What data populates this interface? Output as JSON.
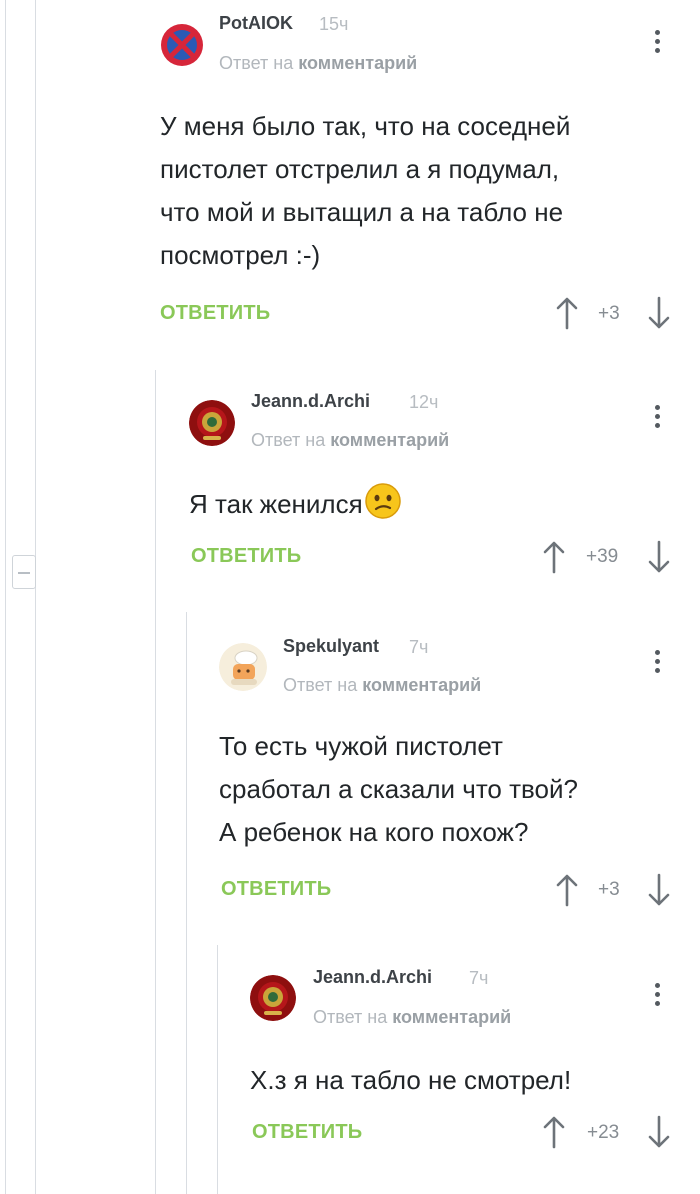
{
  "colors": {
    "accent_green": "#8ac858",
    "thread_line": "#d9dde2"
  },
  "comments": [
    {
      "author": "PotAIOK",
      "time": "15ч",
      "reply_prefix": "Ответ на",
      "reply_target": "комментарий",
      "lines": [
        "У меня было так, что на соседней",
        "пистолет отстрелил а я подумал,",
        "что мой и вытащил а на табло не",
        "посмотрел :-)"
      ],
      "reply_label": "ОТВЕТИТЬ",
      "rating": "+3",
      "avatar": "no-parking-sign-icon"
    },
    {
      "author": "Jeann.d.Archi",
      "time": "12ч",
      "reply_prefix": "Ответ на",
      "reply_target": "комментарий",
      "lines": [
        "Я так женился"
      ],
      "emoji": "confused-face-emoji",
      "reply_label": "ОТВЕТИТЬ",
      "rating": "+39",
      "avatar": "red-emblem-avatar"
    },
    {
      "author": "Spekulyant",
      "time": "7ч",
      "reply_prefix": "Ответ на",
      "reply_target": "комментарий",
      "lines": [
        "То есть чужой пистолет",
        "сработал а сказали что твой?",
        "А ребенок на кого похож?"
      ],
      "reply_label": "ОТВЕТИТЬ",
      "rating": "+3",
      "avatar": "cartoon-chef-avatar"
    },
    {
      "author": "Jeann.d.Archi",
      "time": "7ч",
      "reply_prefix": "Ответ на",
      "reply_target": "комментарий",
      "lines": [
        "Х.з я на табло не смотрел!"
      ],
      "reply_label": "ОТВЕТИТЬ",
      "rating": "+23",
      "avatar": "red-emblem-avatar"
    }
  ]
}
